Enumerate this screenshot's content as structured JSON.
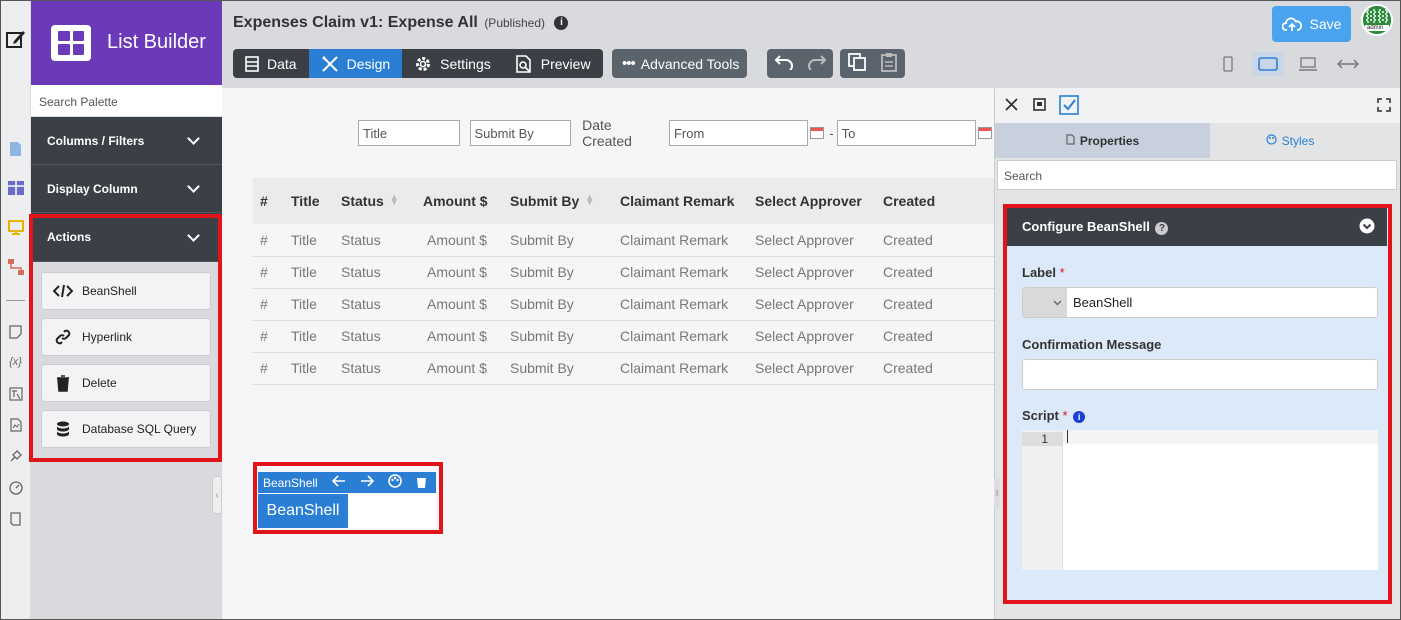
{
  "brand": {
    "name": "List Builder"
  },
  "palette": {
    "search_placeholder": "Search Palette",
    "sections": [
      {
        "label": "Columns / Filters"
      },
      {
        "label": "Display Column"
      },
      {
        "label": "Actions"
      }
    ],
    "actions": [
      {
        "label": "BeanShell",
        "icon": "code-icon"
      },
      {
        "label": "Hyperlink",
        "icon": "link-icon"
      },
      {
        "label": "Delete",
        "icon": "trash-icon"
      },
      {
        "label": "Database SQL Query",
        "icon": "database-icon"
      }
    ]
  },
  "header": {
    "title": "Expenses Claim v1: Expense All",
    "status": "(Published)",
    "tabs": [
      {
        "label": "Data"
      },
      {
        "label": "Design"
      },
      {
        "label": "Settings"
      },
      {
        "label": "Preview"
      }
    ],
    "active_tab": "Design",
    "advanced_tools": "Advanced Tools",
    "save": "Save",
    "avatar_text": "admin"
  },
  "filters": {
    "title_placeholder": "Title",
    "submit_by_placeholder": "Submit By",
    "date_label": "Date Created",
    "from_placeholder": "From",
    "dash": "-",
    "to_placeholder": "To"
  },
  "table": {
    "columns": [
      "#",
      "Title",
      "Status",
      "Amount $",
      "Submit By",
      "Claimant Remark",
      "Select Approver",
      "Created"
    ],
    "rows": [
      [
        "#",
        "Title",
        "Status",
        "Amount $",
        "Submit By",
        "Claimant Remark",
        "Select Approver",
        "Created"
      ],
      [
        "#",
        "Title",
        "Status",
        "Amount $",
        "Submit By",
        "Claimant Remark",
        "Select Approver",
        "Created"
      ],
      [
        "#",
        "Title",
        "Status",
        "Amount $",
        "Submit By",
        "Claimant Remark",
        "Select Approver",
        "Created"
      ],
      [
        "#",
        "Title",
        "Status",
        "Amount $",
        "Submit By",
        "Claimant Remark",
        "Select Approver",
        "Created"
      ],
      [
        "#",
        "Title",
        "Status",
        "Amount $",
        "Submit By",
        "Claimant Remark",
        "Select Approver",
        "Created"
      ]
    ]
  },
  "beanshell_element": {
    "bar_label": "BeanShell",
    "button_label": "BeanShell"
  },
  "properties": {
    "tabs": [
      {
        "label": "Properties"
      },
      {
        "label": "Styles"
      }
    ],
    "search_placeholder": "Search",
    "section_title": "Configure BeanShell",
    "label_field": {
      "label": "Label",
      "required": "*",
      "value": "BeanShell"
    },
    "confirmation_field": {
      "label": "Confirmation Message",
      "value": ""
    },
    "script_field": {
      "label": "Script",
      "required": "*",
      "line_number": "1"
    }
  },
  "colors": {
    "accent": "#2a7fd4",
    "brand": "#6b3ab9",
    "highlight": "#e0141b"
  }
}
